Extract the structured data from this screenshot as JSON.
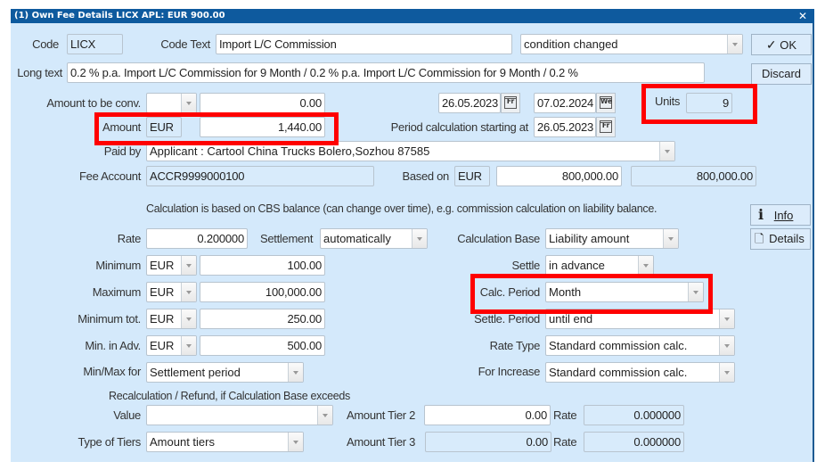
{
  "window": {
    "title": "(1) Own Fee Details LICX APL: EUR 900.00",
    "close_icon": "close-icon"
  },
  "header": {
    "code_label": "Code",
    "code_value": "LICX",
    "code_text_label": "Code Text",
    "code_text_value": "Import L/C Commission",
    "status_value": "condition changed",
    "long_text_label": "Long text",
    "long_text_value": "0.2 % p.a. Import L/C Commission for 9 Month / 0.2 % p.a. Import L/C Commission for 9 Month / 0.2 %"
  },
  "buttons": {
    "ok": "OK",
    "discard": "Discard",
    "info": "Info",
    "details": "Details"
  },
  "amounts": {
    "amount_to_conv_label": "Amount to be conv.",
    "amount_to_conv_currency": "",
    "amount_to_conv_value": "0.00",
    "amount_label": "Amount",
    "amount_currency": "EUR",
    "amount_value": "1,440.00",
    "date_from": "26.05.2023",
    "date_from_day": "Fr",
    "date_to": "07.02.2024",
    "date_to_day": "We",
    "units_label": "Units",
    "units_value": "9",
    "period_start_label": "Period calculation starting at",
    "period_start_value": "26.05.2023",
    "period_start_day": "Fr",
    "paid_by_label": "Paid by",
    "paid_by_value": "Applicant : Cartool China Trucks Bolero,Sozhou 87585",
    "fee_account_label": "Fee Account",
    "fee_account_value": "ACCR9999000100",
    "based_on_label": "Based on",
    "based_on_currency": "EUR",
    "based_on_value": "800,000.00",
    "based_on_value2": "800,000.00"
  },
  "calc": {
    "note": "Calculation is based on CBS balance (can change over time), e.g. commission calculation on liability balance.",
    "rate_label": "Rate",
    "rate_value": "0.200000",
    "settlement_label": "Settlement",
    "settlement_value": "automatically",
    "calc_base_label": "Calculation Base",
    "calc_base_value": "Liability amount",
    "minimum_label": "Minimum",
    "minimum_currency": "EUR",
    "minimum_value": "100.00",
    "settle_label": "Settle",
    "settle_value": "in advance",
    "maximum_label": "Maximum",
    "maximum_currency": "EUR",
    "maximum_value": "100,000.00",
    "calc_period_label": "Calc. Period",
    "calc_period_value": "Month",
    "minimum_tot_label": "Minimum tot.",
    "minimum_tot_currency": "EUR",
    "minimum_tot_value": "250.00",
    "settle_period_label": "Settle. Period",
    "settle_period_value": "until end",
    "min_adv_label": "Min. in Adv.",
    "min_adv_currency": "EUR",
    "min_adv_value": "500.00",
    "rate_type_label": "Rate Type",
    "rate_type_value": "Standard commission calc.",
    "minmax_for_label": "Min/Max for",
    "minmax_for_value": "Settlement period",
    "for_increase_label": "For Increase",
    "for_increase_value": "Standard commission calc."
  },
  "tiers": {
    "recalc_note": "Recalculation / Refund, if Calculation Base exceeds",
    "value_label": "Value",
    "value_value": "",
    "amount_tier2_label": "Amount Tier 2",
    "amount_tier2_value": "0.00",
    "rate2_label": "Rate",
    "rate2_value": "0.000000",
    "type_of_tiers_label": "Type of Tiers",
    "type_of_tiers_value": "Amount tiers",
    "amount_tier3_label": "Amount Tier 3",
    "amount_tier3_value": "0.00",
    "rate3_label": "Rate",
    "rate3_value": "0.000000"
  },
  "highlight_color": "#ff0000"
}
